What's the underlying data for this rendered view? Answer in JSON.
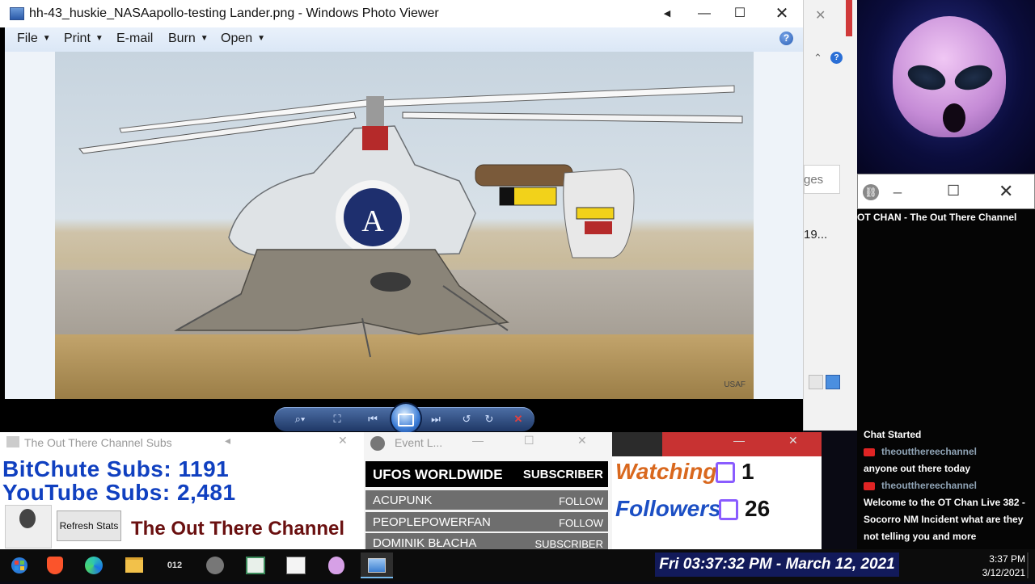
{
  "photo_viewer": {
    "title": "hh-43_huskie_NASAapollo-testing Lander.png - Windows Photo Viewer",
    "menu": [
      "File",
      "Print",
      "E-mail",
      "Burn",
      "Open"
    ],
    "help": "?",
    "photo_credit": "USAF"
  },
  "background_window": {
    "partial_text": "ges",
    "partial_value": "19..."
  },
  "chat": {
    "channel_name": "OT CHAN - The Out There Channel",
    "lines": [
      {
        "type": "status",
        "text": "Chat Started"
      },
      {
        "type": "user",
        "text": "theoutthereechannel"
      },
      {
        "type": "msg",
        "text": "anyone out there today"
      },
      {
        "type": "user",
        "text": "theoutthereechannel"
      },
      {
        "type": "msg",
        "text": "Welcome to the OT Chan Live 382 - Socorro NM Incident what are they not telling you and more"
      }
    ]
  },
  "subs": {
    "title": "The Out There Channel Subs",
    "bitchute": "BitChute Subs: 1191",
    "youtube": "YouTube Subs: 2,481",
    "refresh": "Refresh Stats",
    "brand": "The Out There Channel"
  },
  "events": {
    "title": "Event L...",
    "rows": [
      {
        "name": "UFOS WORLDWIDE",
        "type": "SUBSCRIBER"
      },
      {
        "name": "ACUPUNK",
        "type": "FOLLOW"
      },
      {
        "name": "PEOPLEPOWERFAN",
        "type": "FOLLOW"
      },
      {
        "name": "DOMINIK BŁACHA",
        "type": "SUBSCRIBER"
      }
    ]
  },
  "stats": {
    "watching_label": "Watching",
    "watching_value": "1",
    "followers_label": "Followers",
    "followers_value": "26"
  },
  "taskbar": {
    "banner": "Fri 03:37:32 PM - March 12, 2021",
    "time": "3:37 PM",
    "date": "3/12/2021",
    "counter_icon": "012"
  },
  "colors": {
    "watching": "#d9681e",
    "followers": "#1c4fc4",
    "subs_text": "#1040c0",
    "brand_text": "#6a1010",
    "twitch": "#8a5cff"
  }
}
